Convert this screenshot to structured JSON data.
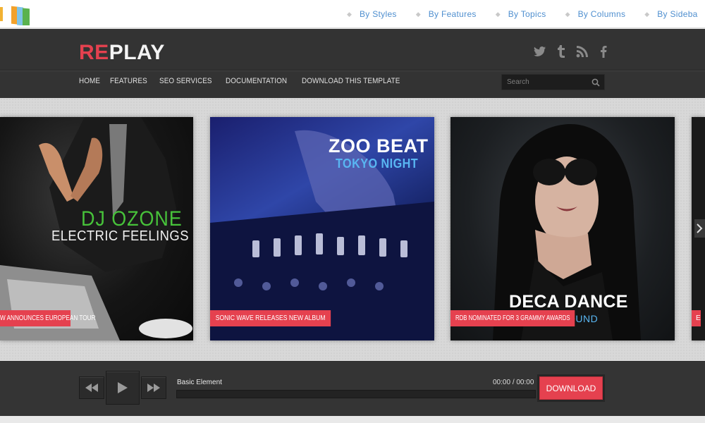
{
  "topnav": {
    "items": [
      {
        "label": "By Styles"
      },
      {
        "label": "By Features"
      },
      {
        "label": "By Topics"
      },
      {
        "label": "By Columns"
      },
      {
        "label": "By Sideba"
      }
    ]
  },
  "header": {
    "brand_red": "RE",
    "brand_white": "PLAY",
    "social": [
      "twitter-icon",
      "tumblr-icon",
      "rss-icon",
      "facebook-icon"
    ],
    "nav": [
      {
        "label": "HOME"
      },
      {
        "label": "FEATURES"
      },
      {
        "label": "SEO SERVICES"
      },
      {
        "label": "DOCUMENTATION"
      },
      {
        "label": "DOWNLOAD THIS TEMPLATE"
      }
    ],
    "search_placeholder": "Search"
  },
  "slides": [
    {
      "title": "DJ OZONE",
      "subtitle": "ELECTRIC FEELINGS",
      "caption": "W ANNOUNCES EUROPEAN TOUR"
    },
    {
      "title": "ZOO BEAT",
      "subtitle": "TOKYO NIGHT",
      "caption": "SONIC WAVE RELEASES NEW ALBUM"
    },
    {
      "title": "DECA DANCE",
      "subtitle": "OUND",
      "caption": "RDB NOMINATED FOR 3 GRAMMY AWARDS"
    },
    {
      "title": "",
      "subtitle": "",
      "caption": "E"
    }
  ],
  "player": {
    "track": "Basic Element",
    "current_time": "00:00",
    "separator": "/",
    "total_time": "00:00",
    "progress": 0,
    "download_label": "DOWNLOAD"
  },
  "colors": {
    "accent": "#e5414f",
    "header_bg": "#333333",
    "topnav_link": "#4f8fcf"
  }
}
